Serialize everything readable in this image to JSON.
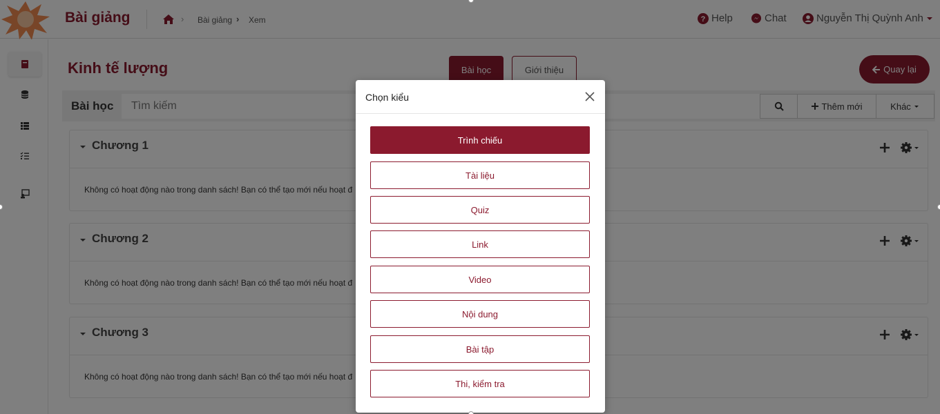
{
  "header": {
    "app_title": "Bài giảng",
    "breadcrumb": [
      "Bài giảng",
      "Xem"
    ],
    "help_label": "Help",
    "chat_label": "Chat",
    "user_name": "Nguyễn Thị Quỳnh Anh"
  },
  "sidebar": {
    "items": [
      {
        "icon": "book-icon",
        "active": true
      },
      {
        "icon": "database-icon",
        "active": false
      },
      {
        "icon": "list-icon",
        "active": false
      },
      {
        "icon": "tasks-icon",
        "active": false
      },
      {
        "icon": "presentation-icon",
        "active": false
      }
    ]
  },
  "page": {
    "title": "Kinh tế lượng",
    "tabs": [
      {
        "label": "Bài học",
        "active": true
      },
      {
        "label": "Giới thiệu",
        "active": false
      }
    ],
    "back_label": "Quay lại"
  },
  "toolbar": {
    "label": "Bài học",
    "search_placeholder": "Tìm kiếm",
    "add_label": "Thêm mới",
    "more_label": "Khác"
  },
  "chapters": [
    {
      "title": "Chương 1",
      "empty_text": "Không có hoạt động nào trong danh sách! Bạn có thể tạo mới nếu hoạt đ"
    },
    {
      "title": "Chương 2",
      "empty_text": "Không có hoạt động nào trong danh sách! Bạn có thể tạo mới nếu hoạt đ"
    },
    {
      "title": "Chương 3",
      "empty_text": "Không có hoạt động nào trong danh sách! Bạn có thể tạo mới nếu hoạt đ"
    }
  ],
  "modal": {
    "title": "Chọn kiểu",
    "options": [
      "Trình chiếu",
      "Tài liệu",
      "Quiz",
      "Link",
      "Video",
      "Nội dung",
      "Bài tập",
      "Thi, kiểm tra"
    ]
  },
  "colors": {
    "brand": "#8b1a2e"
  }
}
